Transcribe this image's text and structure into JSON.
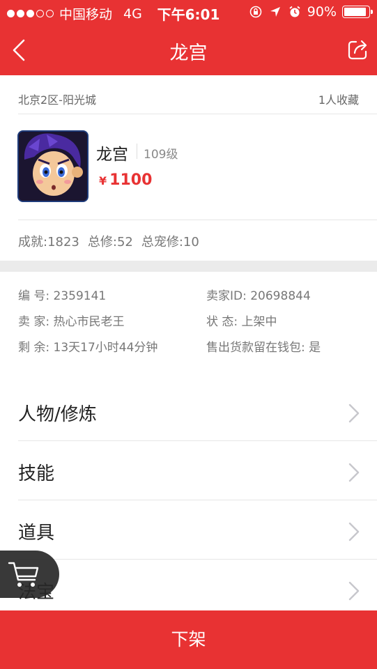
{
  "status_bar": {
    "carrier": "中国移动",
    "network": "4G",
    "time": "下午6:01",
    "battery": "90%",
    "battery_level": 0.9
  },
  "nav": {
    "title": "龙宫",
    "back_icon": "chevron-left-icon",
    "share_icon": "share-icon"
  },
  "listing": {
    "server": "北京2区-阳光城",
    "favorites": "1人收藏",
    "name": "龙宫",
    "level": "109级",
    "currency": "¥",
    "price": "1100",
    "stats": [
      "成就:1823",
      "总修:52",
      "总宠修:10"
    ]
  },
  "details": {
    "number": "编  号: 2359141",
    "seller_id": "卖家ID: 20698844",
    "seller": "卖  家: 热心市民老王",
    "status": "状  态: 上架中",
    "remaining": "剩  余: 13天17小时44分钟",
    "wallet": "售出货款留在钱包: 是"
  },
  "menu": [
    {
      "label": "人物/修炼"
    },
    {
      "label": "技能"
    },
    {
      "label": "道具"
    },
    {
      "label": "法宝"
    }
  ],
  "cart_icon": "cart-icon",
  "bottom_button": "下架",
  "colors": {
    "accent": "#e83233",
    "separator": "#ebebeb"
  }
}
